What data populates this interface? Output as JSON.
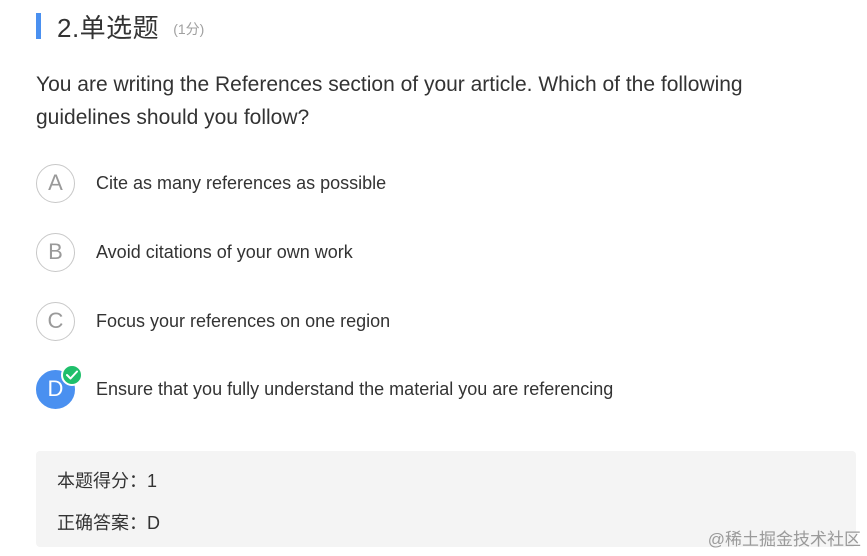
{
  "question": {
    "number_title": "2.单选题",
    "score_label": "(1分)",
    "text": "You are writing the References section of your article. Which of the following guidelines should you follow?"
  },
  "options": [
    {
      "letter": "A",
      "text": "Cite as many references as possible",
      "selected": false
    },
    {
      "letter": "B",
      "text": "Avoid citations of your own work",
      "selected": false
    },
    {
      "letter": "C",
      "text": "Focus your references on one region",
      "selected": false
    },
    {
      "letter": "D",
      "text": "Ensure that you fully understand the material you are referencing",
      "selected": true,
      "badge_icon": "check-icon"
    }
  ],
  "result": {
    "score_line": "本题得分：1",
    "answer_line": "正确答案：D"
  },
  "watermark": "@稀土掘金技术社区",
  "colors": {
    "accent": "#4a90f0",
    "correct_badge": "#1fbf6b",
    "result_bg": "#f4f4f4"
  }
}
